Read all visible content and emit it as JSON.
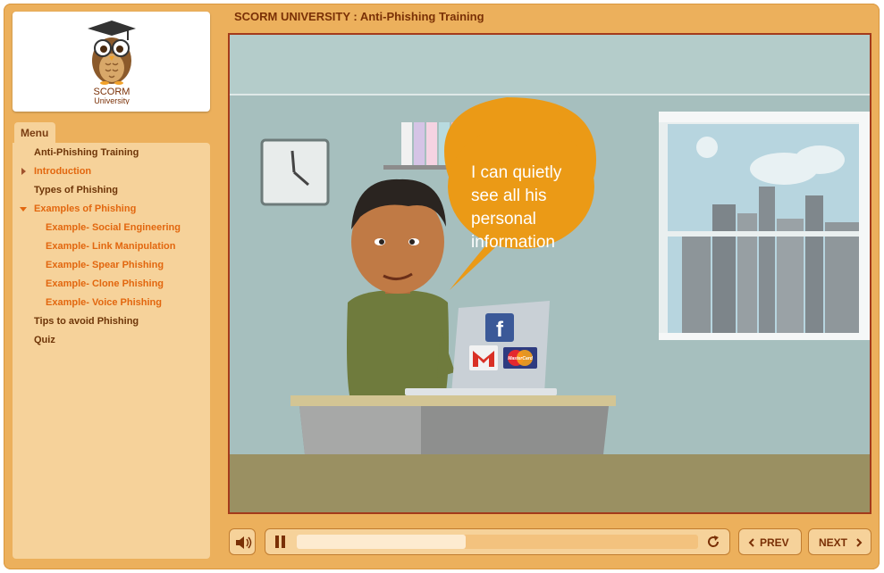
{
  "course_title": "SCORM UNIVERSITY : Anti-Phishing Training",
  "logo": {
    "line1": "SCORM",
    "line2": "University"
  },
  "menu": {
    "tab_label": "Menu",
    "items": [
      {
        "label": "Anti-Phishing Training",
        "style": "dark",
        "arrow": "none"
      },
      {
        "label": "Introduction",
        "style": "orange",
        "arrow": "right"
      },
      {
        "label": "Types of Phishing",
        "style": "dark",
        "arrow": "none"
      },
      {
        "label": "Examples of Phishing",
        "style": "orange",
        "arrow": "down"
      },
      {
        "label": "Example- Social Engineering",
        "style": "orange",
        "arrow": "none"
      },
      {
        "label": "Example- Link Manipulation",
        "style": "orange",
        "arrow": "none"
      },
      {
        "label": "Example- Spear Phishing",
        "style": "orange",
        "arrow": "none"
      },
      {
        "label": "Example- Clone Phishing",
        "style": "orange",
        "arrow": "none"
      },
      {
        "label": "Example- Voice Phishing",
        "style": "orange",
        "arrow": "none"
      },
      {
        "label": "Tips to avoid Phishing",
        "style": "dark",
        "arrow": "none"
      },
      {
        "label": "Quiz",
        "style": "dark",
        "arrow": "none"
      }
    ]
  },
  "scene": {
    "speech_lines": [
      "I can quietly",
      "see all his",
      "personal",
      "information"
    ],
    "icons": [
      "facebook-icon",
      "gmail-icon",
      "mastercard-icon"
    ],
    "mastercard_text": "MasterCard"
  },
  "controls": {
    "prev_label": "PREV",
    "next_label": "NEXT",
    "progress_fraction": 0.42,
    "volume_icon": "speaker-icon",
    "pause_icon": "pause-icon",
    "replay_icon": "replay-icon"
  },
  "colors": {
    "frame": "#ecb05c",
    "panel": "#f6d29a",
    "accent_dark": "#7a3006",
    "accent_orange": "#e2670f",
    "stage_border": "#a33a1b",
    "speech_bubble": "#eb9a16"
  }
}
